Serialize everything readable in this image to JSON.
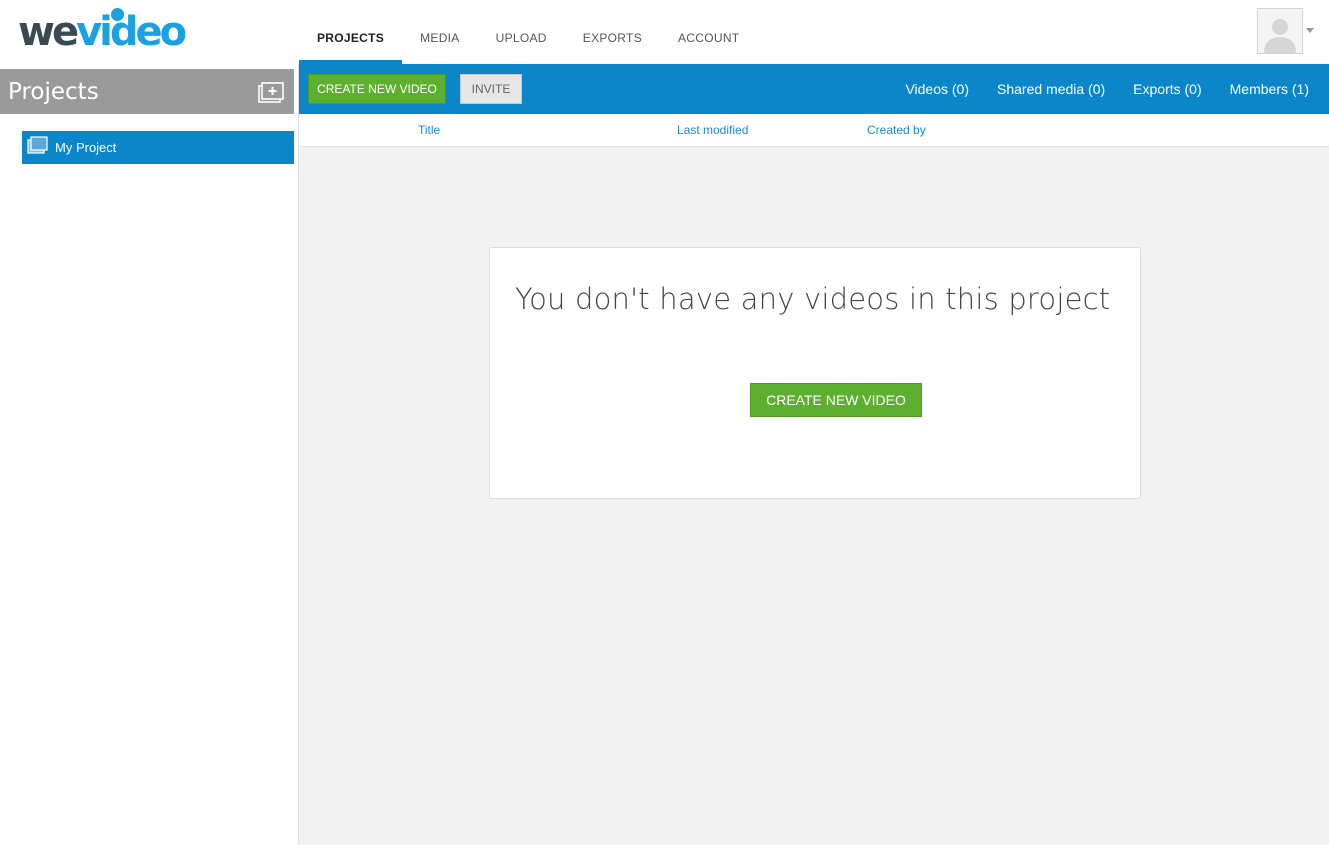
{
  "brand": {
    "logo_text_we": "we",
    "logo_text_video": "video",
    "colors": {
      "dark": "#3a4a55",
      "blue": "#1aa1e0",
      "accent": "#0a86c9",
      "green": "#5db02f"
    }
  },
  "nav": {
    "tabs": [
      {
        "label": "PROJECTS",
        "active": true
      },
      {
        "label": "MEDIA",
        "active": false
      },
      {
        "label": "UPLOAD",
        "active": false
      },
      {
        "label": "EXPORTS",
        "active": false
      },
      {
        "label": "ACCOUNT",
        "active": false
      }
    ]
  },
  "user": {
    "avatar_icon": "user-silhouette-icon"
  },
  "sidebar": {
    "title": "Projects",
    "add_icon": "add-project-icon",
    "projects": [
      {
        "label": "My Project",
        "selected": true,
        "icon": "project-folder-icon"
      }
    ]
  },
  "toolbar": {
    "create_label": "CREATE NEW VIDEO",
    "invite_label": "INVITE",
    "links": [
      "Videos (0)",
      "Shared media (0)",
      "Exports (0)",
      "Members (1)"
    ]
  },
  "columns": [
    "Title",
    "Last modified",
    "Created by"
  ],
  "empty_state": {
    "message": "You don't have any videos in this project",
    "button_label": "CREATE NEW VIDEO"
  }
}
